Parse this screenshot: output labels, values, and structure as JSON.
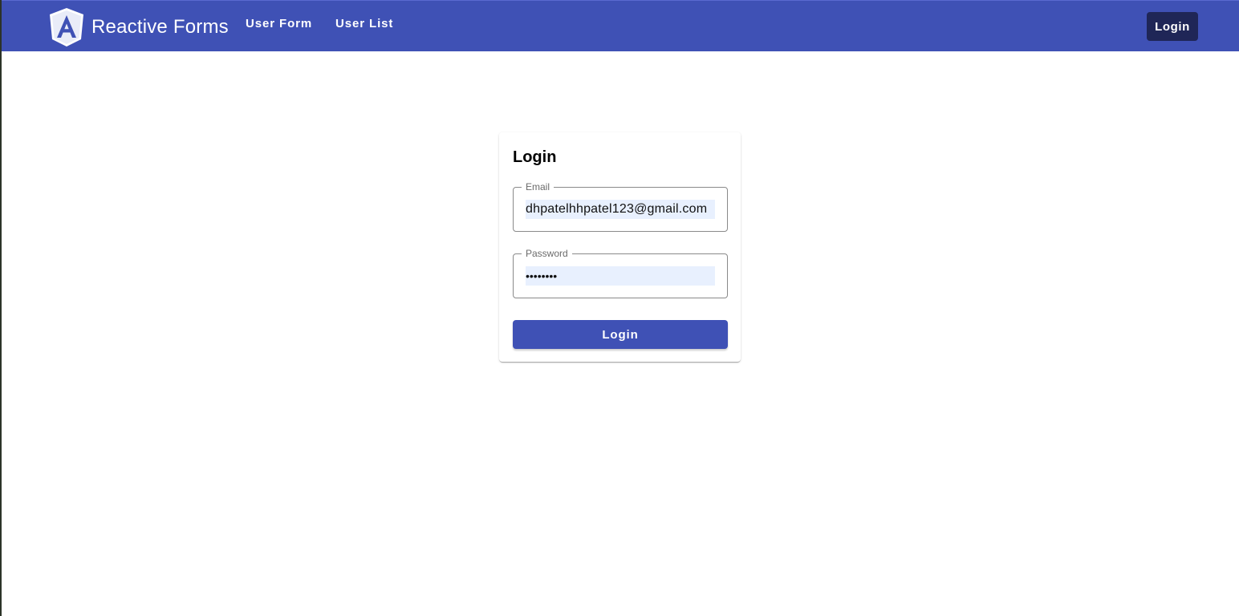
{
  "app": {
    "title": "Reactive Forms",
    "logo_icon": "angular-logo-icon"
  },
  "nav": {
    "items": [
      {
        "label": "User Form"
      },
      {
        "label": "User List"
      }
    ],
    "login_label": "Login"
  },
  "login_form": {
    "title": "Login",
    "email": {
      "label": "Email",
      "value": "dhpatelhhpatel123@gmail.com"
    },
    "password": {
      "label": "Password",
      "value": "••••••••"
    },
    "submit_label": "Login"
  },
  "colors": {
    "primary": "#3f51b5",
    "toolbar_login_bg": "#1f2657",
    "autofill_bg": "#e8f0fe"
  }
}
